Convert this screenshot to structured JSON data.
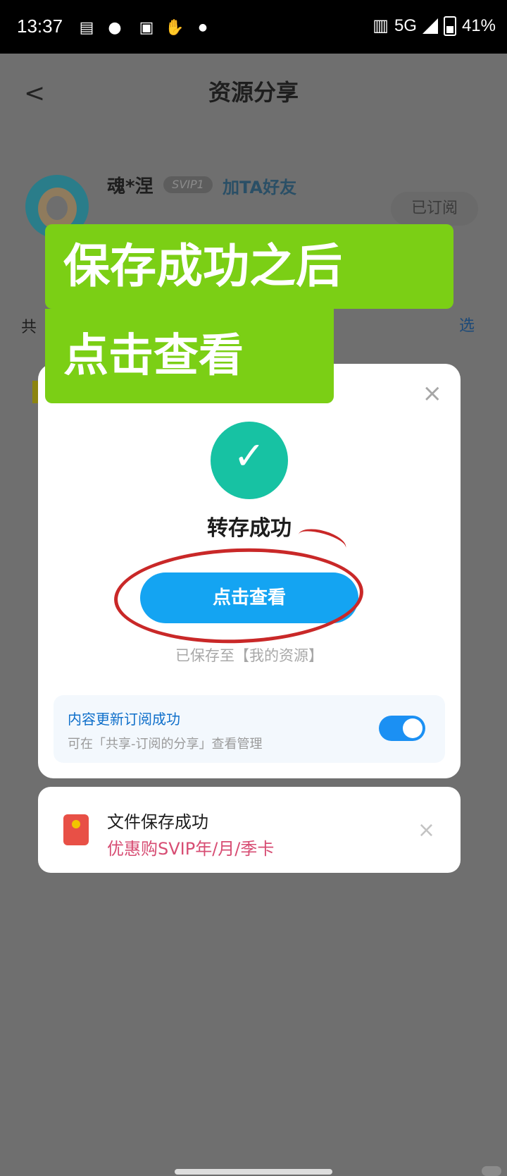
{
  "status_bar": {
    "time": "13:37",
    "network": "5G",
    "battery": "41%"
  },
  "header": {
    "back_label": "<",
    "title": "资源分享"
  },
  "profile": {
    "username": "魂*涅",
    "badge": "SVIP1",
    "add_friend": "加TA好友",
    "subscribed_button": "已订阅"
  },
  "background_partials": {
    "left_text": "共",
    "right_text": "选"
  },
  "overlay_text": {
    "line1": "保存成功之后",
    "line2": "点击查看"
  },
  "modal": {
    "title": "转存成功",
    "view_button": "点击查看",
    "saved_to": "已保存至【我的资源】",
    "subscription_title": "内容更新订阅成功",
    "subscription_desc": "可在「共享-订阅的分享」查看管理",
    "toggle_state": "on"
  },
  "toast": {
    "title": "文件保存成功",
    "promo": "优惠购SVIP年/月/季卡"
  },
  "colors": {
    "accent_blue": "#14a4f2",
    "success_green": "#17c2a3",
    "overlay_green": "#7bcf15",
    "promo_pink": "#d74d73"
  }
}
